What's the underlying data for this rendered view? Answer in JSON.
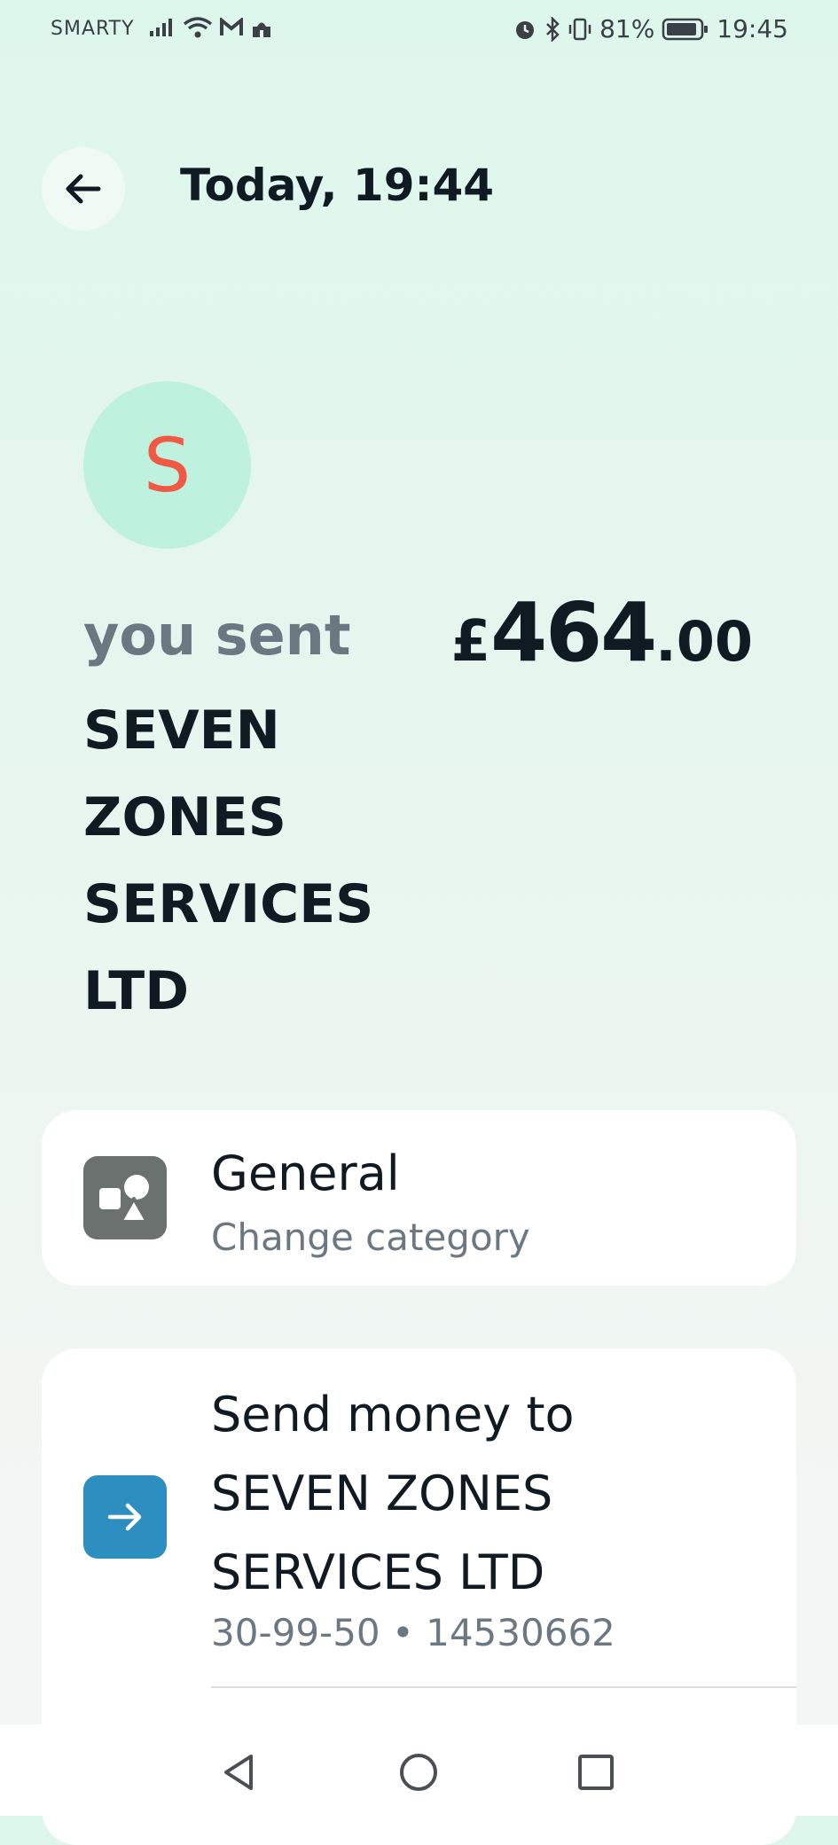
{
  "status_bar": {
    "carrier": "SMARTY",
    "battery": "81%",
    "time": "19:45",
    "icons": [
      "signal-icon",
      "wifi-icon",
      "gmail-icon",
      "mosque-icon",
      "alarm-icon",
      "bluetooth-icon",
      "vibrate-icon",
      "battery-icon"
    ]
  },
  "header": {
    "title": "Today, 19:44",
    "back_icon": "arrow-left-icon"
  },
  "transaction": {
    "avatar_letter": "S",
    "label": "you sent",
    "recipient_lines": [
      "SEVEN",
      "ZONES",
      "SERVICES",
      "LTD"
    ],
    "amount_currency": "£",
    "amount_main": "464",
    "amount_decimal": ".00"
  },
  "category": {
    "title": "General",
    "subtitle": "Change category",
    "icon": "shapes-icon"
  },
  "send_money": {
    "lines": [
      "Send money to",
      "SEVEN ZONES",
      "SERVICES LTD"
    ],
    "account": "30-99-50 • 14530662",
    "icon": "arrow-right-icon"
  },
  "colors": {
    "avatar_bg": "#bff2de",
    "avatar_letter": "#f05a44",
    "category_icon_bg": "#6b716f",
    "send_icon_bg": "#2d8fc0"
  },
  "navbar": {
    "icons": [
      "back-triangle-icon",
      "home-circle-icon",
      "recents-square-icon"
    ]
  }
}
